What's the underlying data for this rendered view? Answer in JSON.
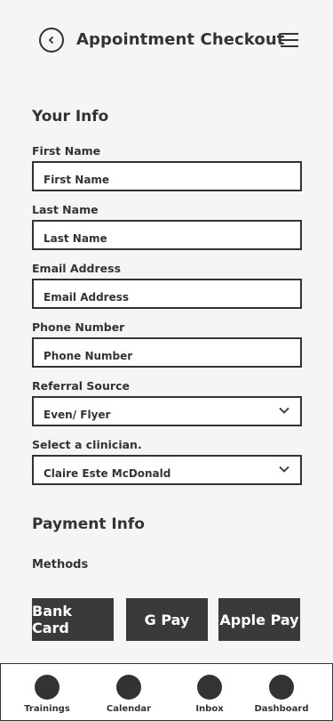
{
  "header": {
    "title": "Appointment Checkout",
    "back_icon": "chevron-left-icon",
    "menu_icon": "hamburger-menu-icon"
  },
  "your_info": {
    "title": "Your Info",
    "fields": [
      {
        "label": "First Name",
        "value": "First Name"
      },
      {
        "label": "Last Name",
        "value": "Last Name"
      },
      {
        "label": "Email Address",
        "value": "Email Address"
      },
      {
        "label": "Phone Number",
        "value": "Phone Number"
      },
      {
        "label": "Referral Source",
        "value": "Even/ Flyer"
      },
      {
        "label": "Select a clinician.",
        "value": "Claire Este McDonald"
      }
    ]
  },
  "payment": {
    "title": "Payment Info",
    "methods_label": "Methods",
    "buttons": [
      "Bank Card",
      "G Pay",
      "Apple Pay"
    ]
  },
  "nav": {
    "items": [
      "Trainings",
      "Calendar",
      "Inbox",
      "Dashboard"
    ]
  },
  "colors": {
    "background": "#f5f5f5",
    "dark": "#333333",
    "button": "#3a3a3a"
  }
}
